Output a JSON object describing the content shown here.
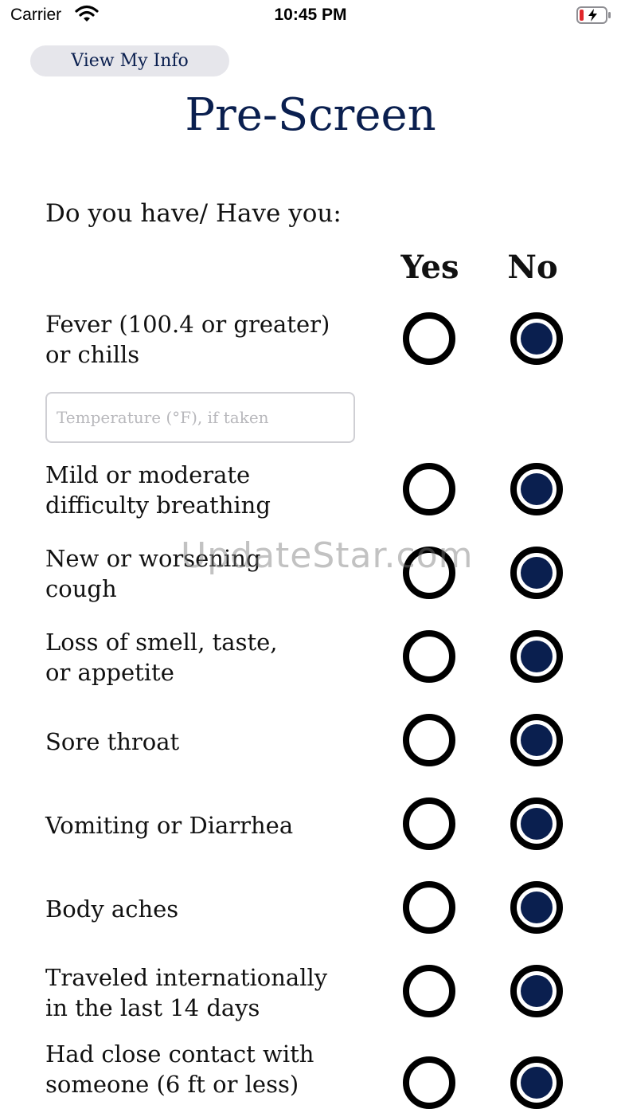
{
  "status_bar": {
    "carrier": "Carrier",
    "time": "10:45 PM"
  },
  "header": {
    "view_info_label": "View My Info",
    "title": "Pre-Screen"
  },
  "form": {
    "prompt": "Do you have/ Have you:",
    "col_yes": "Yes",
    "col_no": "No",
    "temperature_placeholder": "Temperature (°F), if taken",
    "questions": [
      {
        "label": "Fever (100.4 or greater)\nor chills",
        "answer": "No"
      },
      {
        "label": "Mild or moderate\ndifficulty breathing",
        "answer": "No"
      },
      {
        "label": "New or worsening\ncough",
        "answer": "No"
      },
      {
        "label": "Loss of smell, taste,\nor appetite",
        "answer": "No"
      },
      {
        "label": "Sore throat",
        "answer": "No"
      },
      {
        "label": "Vomiting or Diarrhea",
        "answer": "No"
      },
      {
        "label": "Body aches",
        "answer": "No"
      },
      {
        "label": "Traveled internationally\nin the last 14 days",
        "answer": "No"
      },
      {
        "label": "Had close contact with\nsomeone (6 ft or less)",
        "answer": "No"
      }
    ]
  },
  "watermark": "UpdateStar.com",
  "colors": {
    "accent": "#0a1f4f",
    "radio_border": "#000000",
    "button_bg": "#e6e6eb"
  },
  "icons": {
    "wifi": "wifi-icon",
    "battery": "battery-charging-icon"
  }
}
